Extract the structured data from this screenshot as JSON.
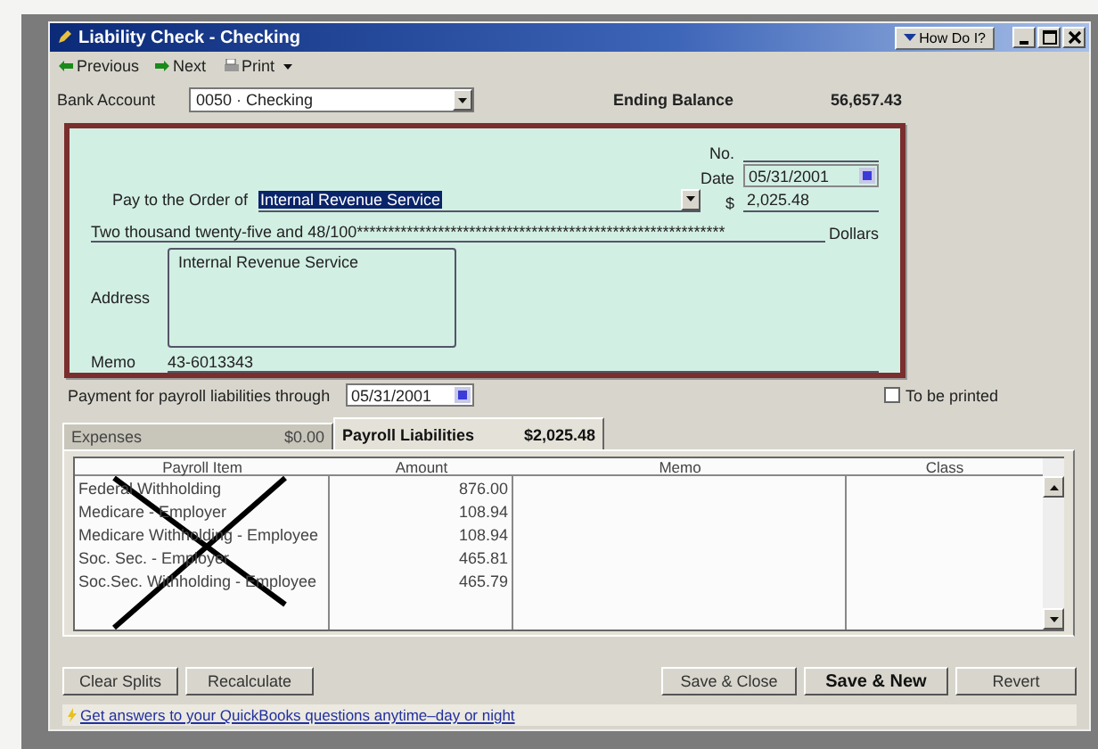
{
  "window": {
    "title": "Liability Check - Checking",
    "help_button": "How Do I?"
  },
  "toolbar": [
    {
      "label": "Previous",
      "kind": "prev"
    },
    {
      "label": "Next",
      "kind": "next"
    },
    {
      "label": "Print",
      "kind": "print"
    }
  ],
  "bank_account": {
    "label": "Bank Account",
    "value": "0050 · Checking"
  },
  "ending_balance": {
    "label": "Ending Balance",
    "value": "56,657.43"
  },
  "check": {
    "no_label": "No.",
    "date_label": "Date",
    "date": "05/31/2001",
    "pay_label": "Pay to the Order of",
    "payee": "Internal Revenue Service",
    "payee_selected": true,
    "dollar_sign": "$",
    "amount": "2,025.48",
    "amount_words": "Two thousand twenty-five and 48/100***********************************************************",
    "dollars_label": "Dollars",
    "address_label": "Address",
    "address": "Internal Revenue Service",
    "memo_label": "Memo",
    "memo": "43-6013343"
  },
  "payment_through": {
    "label": "Payment for payroll liabilities through",
    "date": "05/31/2001"
  },
  "to_be_printed": {
    "label": "To be printed",
    "checked": false
  },
  "tabs": [
    {
      "label": "Expenses",
      "amount": "$0.00",
      "selected": false
    },
    {
      "label": "Payroll Liabilities",
      "amount": "$2,025.48",
      "selected": true
    }
  ],
  "table": {
    "columns": [
      "Payroll Item",
      "Amount",
      "Memo",
      "Class"
    ],
    "rows": [
      [
        "Federal Withholding",
        "876.00"
      ],
      [
        "Medicare - Employer",
        "108.94"
      ],
      [
        "Medicare Withholding - Employee",
        "108.94"
      ],
      [
        "Soc. Sec. - Employer",
        "465.81"
      ],
      [
        "Soc.Sec. Withholding - Employee",
        "465.79"
      ]
    ]
  },
  "buttons": [
    {
      "label": "Clear Splits",
      "kind": "left",
      "default": false
    },
    {
      "label": "Recalculate",
      "kind": "left",
      "default": false
    },
    {
      "label": "Save & Close",
      "kind": "right",
      "default": false
    },
    {
      "label": "Save & New",
      "kind": "right",
      "default": true
    },
    {
      "label": "Revert",
      "kind": "right",
      "default": false
    }
  ],
  "help_link": "Get answers to your QuickBooks questions anytime–day or night"
}
